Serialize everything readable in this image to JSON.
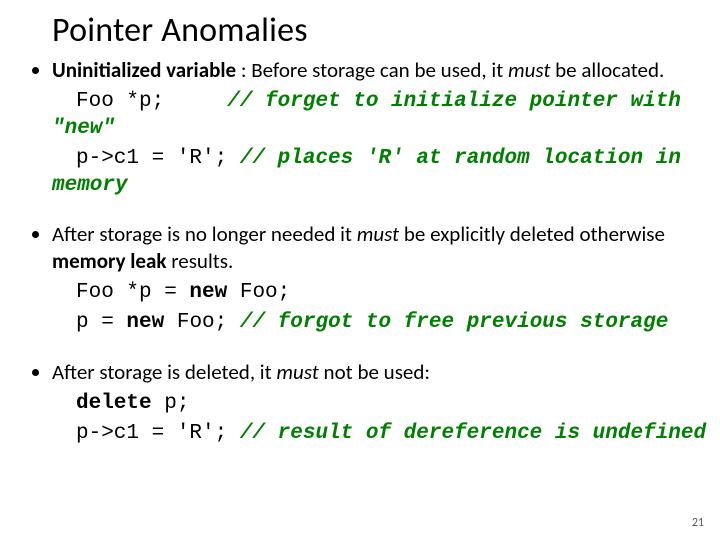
{
  "title": "Pointer Anomalies",
  "pagenum": "21",
  "b1": {
    "lead_bold": "Uninitialized variable",
    "lead_rest": " : Before storage can be used, it ",
    "must": "must",
    "lead_tail": " be allocated.",
    "code1": "Foo *p;",
    "com1": "// forget to initialize pointer with",
    "com1b": "\"new\"",
    "code2": "p->c1 = 'R';",
    "com2": "// places 'R' at random location in",
    "com2b": "memory"
  },
  "b2": {
    "lead_a": "After storage is no longer needed it ",
    "must": "must",
    "lead_b": " be explicitly deleted otherwise ",
    "leak": "memory leak",
    "lead_c": " results.",
    "code1a": "Foo *p = ",
    "code1_new": "new",
    "code1b": " Foo;",
    "code2a": "p = ",
    "code2_new": "new",
    "code2b": " Foo; ",
    "com2": "// forgot to free previous storage"
  },
  "b3": {
    "lead_a": "After storage is deleted, it ",
    "must": "must",
    "lead_b": " not be used:",
    "code1_del": "delete",
    "code1b": " p;",
    "code2": "p->c1 = 'R'; ",
    "com2": "// result of dereference is undefined"
  }
}
